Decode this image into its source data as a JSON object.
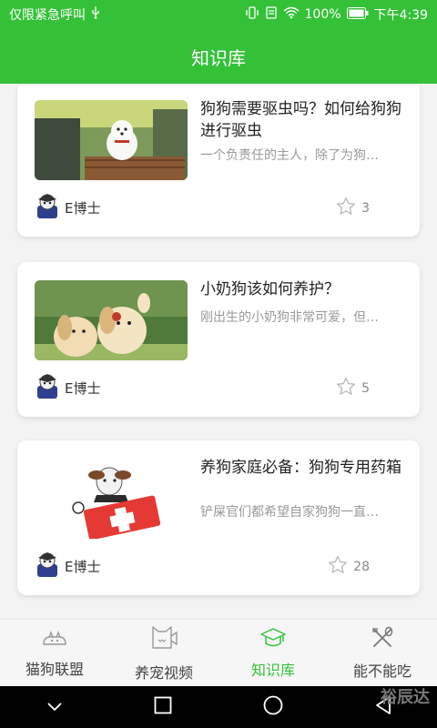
{
  "status_bar": {
    "carrier": "仅限紧急呼叫",
    "battery": "100%",
    "time": "下午4:39"
  },
  "header": {
    "title": "知识库"
  },
  "articles": [
    {
      "title": "狗狗需要驱虫吗？如何给狗狗进行驱虫",
      "desc": "一个负责任的主人，除了为狗…",
      "author": "E博士",
      "likes": "3",
      "image_icon": "dog-on-bench-image"
    },
    {
      "title": "小奶狗该如何养护？",
      "desc": "刚出生的小奶狗非常可爱，但…",
      "author": "E博士",
      "likes": "5",
      "image_icon": "puppies-image"
    },
    {
      "title": "养狗家庭必备：狗狗专用药箱",
      "desc": "铲屎官们都希望自家狗狗一直…",
      "author": "E博士",
      "likes": "28",
      "image_icon": "dog-first-aid-kit-image"
    }
  ],
  "tabs": [
    {
      "label": "猫狗联盟",
      "icon": "pet-alliance-icon"
    },
    {
      "label": "养宠视频",
      "icon": "cat-video-icon"
    },
    {
      "label": "知识库",
      "icon": "graduation-cap-icon"
    },
    {
      "label": "能不能吃",
      "icon": "fork-knife-icon"
    }
  ],
  "colors": {
    "accent": "#34c138"
  },
  "watermark": "裕辰达"
}
